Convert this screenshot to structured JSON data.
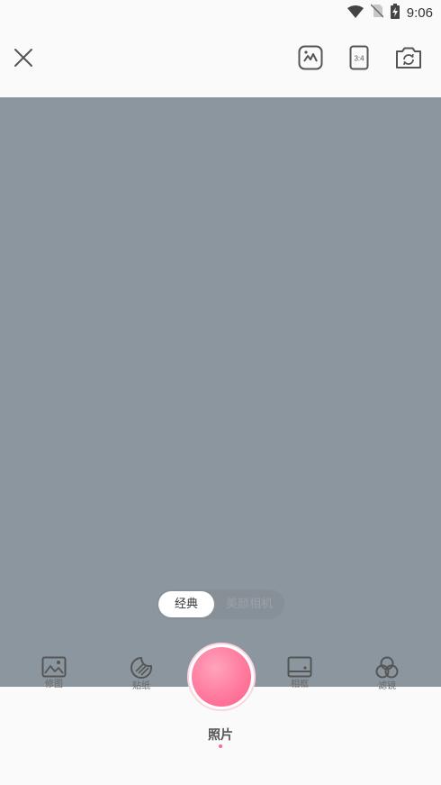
{
  "status_bar": {
    "time": "9:06",
    "icons": [
      "wifi-icon",
      "no-sim-icon",
      "battery-charging-icon"
    ]
  },
  "toolbar": {
    "close_icon": "close-icon",
    "gallery_icon": "gallery-icon",
    "aspect_ratio_label": "3:4",
    "switch_camera_icon": "switch-camera-icon"
  },
  "mode_toggle": {
    "options": [
      "经典",
      "美颜相机"
    ],
    "selected": "经典"
  },
  "tools": [
    {
      "label": "修图",
      "icon": "photo-edit-icon"
    },
    {
      "label": "贴纸",
      "icon": "sticker-icon"
    },
    {
      "label": "相框",
      "icon": "frame-icon"
    },
    {
      "label": "滤镜",
      "icon": "filter-icon"
    }
  ],
  "capture_mode": {
    "label": "照片"
  },
  "colors": {
    "accent": "#fc6a8f",
    "viewfinder": "#8c969e",
    "background": "#fafafa"
  }
}
